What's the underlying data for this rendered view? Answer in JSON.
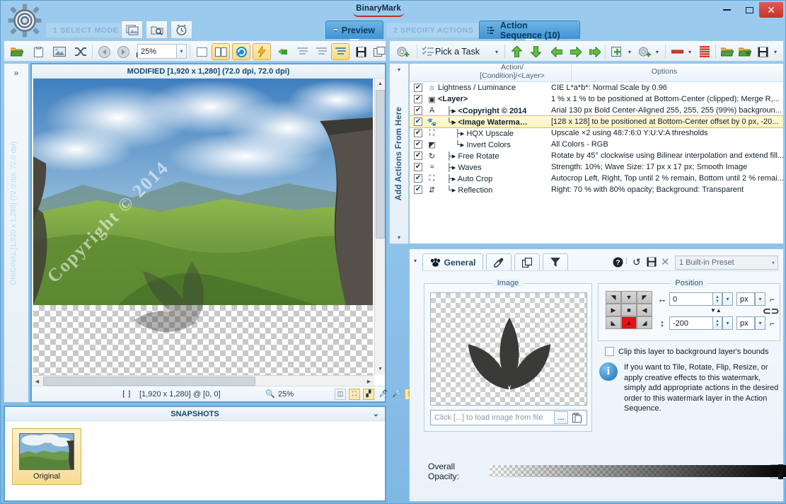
{
  "window": {
    "brand": "BinaryMark",
    "minimize": "–",
    "maximize": "□",
    "close": "✕"
  },
  "modes": {
    "step1": "1 SELECT MODE",
    "step2": "2 SPECIFY ACTIONS",
    "tab_preview": "Preview",
    "tab_action_sequence": "Action Sequence (10)"
  },
  "left_toolbar": {
    "zoom_value": "25%",
    "icons": [
      "open-folder-icon",
      "clipboard-icon",
      "image-icon",
      "shuffle-icon",
      "back-arrow-icon",
      "forward-arrow-icon",
      "histogram-icon"
    ]
  },
  "right_toolbar": {
    "pick_a_task": "Pick a Task"
  },
  "preview": {
    "title": "MODIFIED [1,920 x 1,280] (72.0 dpi, 72.0 dpi)",
    "original_label": "ORIGINAL [1,920 x 1,280] (72.0 dpi, 72.0 dpi)",
    "status_selection": "[1,920 x 1,280] @ [0, 0]",
    "status_zoom": "25%",
    "expand_chevron": "»"
  },
  "snapshots": {
    "title": "SNAPSHOTS",
    "collapse_chevron": "⌄",
    "items": [
      {
        "caption": "Original"
      }
    ]
  },
  "add_actions": {
    "label": "Add Actions From Here"
  },
  "sequence": {
    "header_col1_line1": "Action/",
    "header_col1_line2": "[Condition]/<Layer>",
    "header_col2": "Options",
    "rows": [
      {
        "checked": "✔",
        "icon": "brightness-icon",
        "name": "Lightness / Luminance",
        "indent": 0,
        "bold": false,
        "selected": false,
        "options": "CIE L*a*b*: Normal Scale by 0.96"
      },
      {
        "checked": "✔",
        "icon": "layer-icon",
        "name": "<Layer>",
        "indent": 0,
        "bold": true,
        "selected": false,
        "options": "1 % x 1 % to be positioned at Bottom-Center (clipped); Merge R,..."
      },
      {
        "checked": "✔",
        "icon": "text-A-icon",
        "name": "<Copyright © 2014",
        "indent": 1,
        "prefix": "├▸",
        "bold": true,
        "selected": false,
        "options": "Arial 130 px Bold Center-Aligned 255, 255, 255 (99%) backgroun..."
      },
      {
        "checked": "✔",
        "icon": "paw-icon",
        "name": "<Image Waterma…",
        "indent": 1,
        "prefix": "└▸",
        "bold": true,
        "selected": true,
        "options": "[128 x 128] to be positioned at Bottom-Center offset by 0 px, -20..."
      },
      {
        "checked": "✔",
        "icon": "upscale-icon",
        "name": "HQX Upscale",
        "indent": 2,
        "prefix": "├▸",
        "bold": false,
        "selected": false,
        "options": "Upscale ×2 using 48:7:6:0 Y:U:V:A thresholds"
      },
      {
        "checked": "✔",
        "icon": "invert-icon",
        "name": "Invert Colors",
        "indent": 2,
        "prefix": "└▸",
        "bold": false,
        "selected": false,
        "options": "All Colors - RGB"
      },
      {
        "checked": "✔",
        "icon": "rotate-icon",
        "name": "Free Rotate",
        "indent": 1,
        "prefix": "├▸",
        "bold": false,
        "selected": false,
        "options": "Rotate by 45° clockwise using Bilinear interpolation and extend fill..."
      },
      {
        "checked": "✔",
        "icon": "waves-icon",
        "name": "Waves",
        "indent": 1,
        "prefix": "├▸",
        "bold": false,
        "selected": false,
        "options": "Strength: 10%; Wave Size: 17 px x 17 px; Smooth Image"
      },
      {
        "checked": "✔",
        "icon": "crop-icon",
        "name": "Auto Crop",
        "indent": 1,
        "prefix": "├▸",
        "bold": false,
        "selected": false,
        "options": "Autocrop Left, Right, Top until 2 % remain, Bottom until 2 % remai..."
      },
      {
        "checked": "✔",
        "icon": "reflection-icon",
        "name": "Reflection",
        "indent": 1,
        "prefix": "└▸",
        "bold": false,
        "selected": false,
        "options": "Right: 70 % with 80% opacity; Background: Transparent"
      }
    ]
  },
  "options_panel": {
    "tab_general": "General",
    "tab_eyedropper": "eyedropper-icon",
    "tab_copies": "copies-icon",
    "tab_filter": "filter-icon",
    "help_icon": "help-icon",
    "undo_icon": "undo-icon",
    "save_icon": "save-icon",
    "delete_icon": "delete-icon",
    "preset_value": "1 Built-in Preset",
    "image_group_label": "Image",
    "image_placeholder": "Click [...] to load image from file",
    "browse_button": "...",
    "paste_button": "paste-icon",
    "position_group_label": "Position",
    "x_value": "0",
    "x_unit": "px",
    "y_value": "-200",
    "y_unit": "px",
    "clip_checkbox_label": "Clip this layer to background layer's bounds",
    "info_text": "If you want to Tile, Rotate, Flip, Resize, or apply creative effects to this watermark, simply add appropriate actions in the desired order to this watermark layer in the Action Sequence.",
    "opacity_label": "Overall Opacity:",
    "opacity_value": "99.6%"
  }
}
